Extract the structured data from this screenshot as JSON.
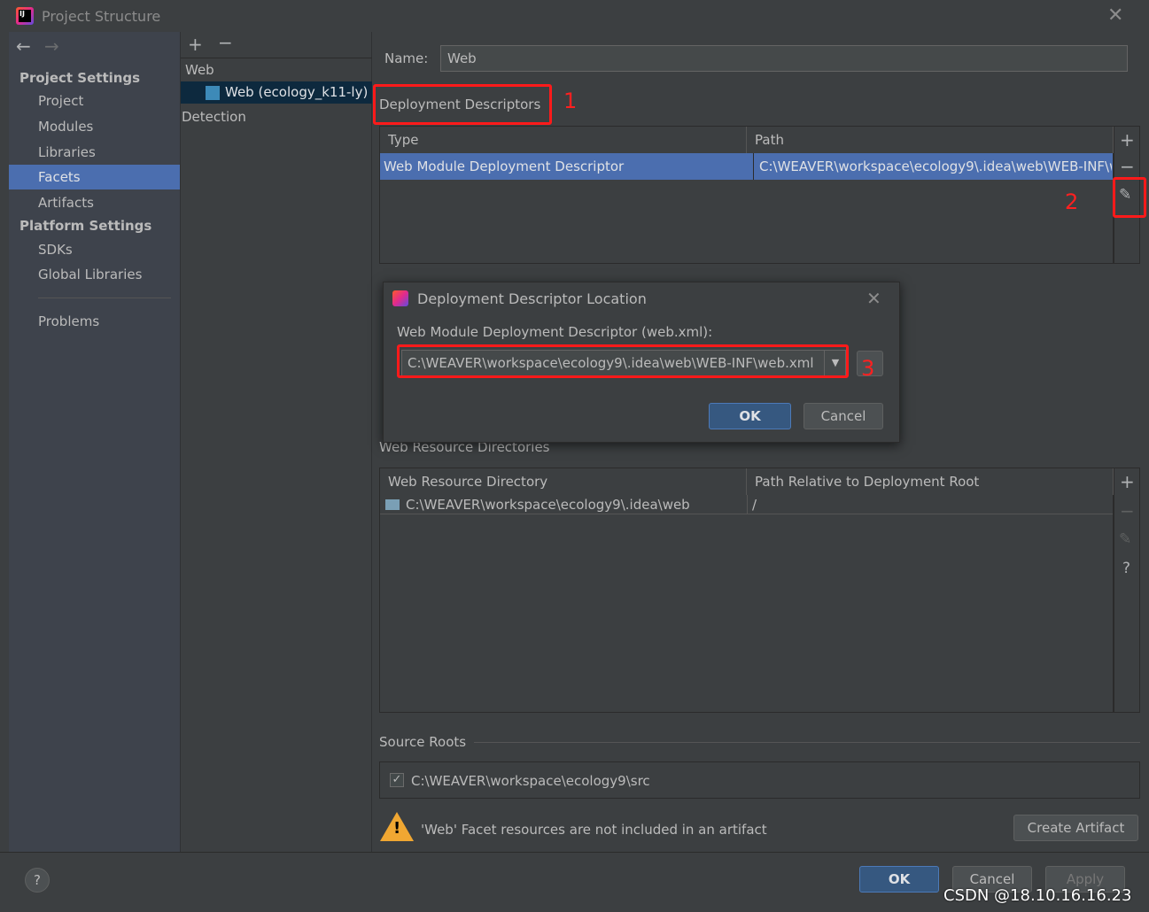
{
  "window": {
    "title": "Project Structure"
  },
  "sidebar": {
    "project_settings": "Project Settings",
    "items": [
      "Project",
      "Modules",
      "Libraries",
      "Facets",
      "Artifacts"
    ],
    "platform_settings": "Platform Settings",
    "platform_items": [
      "SDKs",
      "Global Libraries"
    ],
    "problems": "Problems",
    "selected": "Facets"
  },
  "tree": {
    "root": "Web",
    "child": "Web (ecology_k11-ly)",
    "detection": "Detection"
  },
  "main": {
    "name_label": "Name:",
    "name_value": "Web",
    "deployment_descriptors": "Deployment Descriptors",
    "dd_table": {
      "headers": [
        "Type",
        "Path"
      ],
      "rows": [
        [
          "Web Module Deployment Descriptor",
          "C:\\WEAVER\\workspace\\ecology9\\.idea\\web\\WEB-INF\\w"
        ]
      ]
    },
    "web_resource_directories": "Web Resource Directories",
    "wr_table": {
      "headers": [
        "Web Resource Directory",
        "Path Relative to Deployment Root"
      ],
      "rows": [
        [
          "C:\\WEAVER\\workspace\\ecology9\\.idea\\web",
          "/"
        ]
      ]
    },
    "source_roots": "Source Roots",
    "source_root": "C:\\WEAVER\\workspace\\ecology9\\src",
    "source_root_checked": true,
    "warning": "'Web' Facet resources are not included in an artifact",
    "create_artifact": "Create Artifact"
  },
  "dialog": {
    "title": "Deployment Descriptor Location",
    "label": "Web Module Deployment Descriptor (web.xml):",
    "path_value": "C:\\WEAVER\\workspace\\ecology9\\.idea\\web\\WEB-INF\\web.xml",
    "ok": "OK",
    "cancel": "Cancel"
  },
  "annotations": [
    "1",
    "2",
    "3"
  ],
  "footer": {
    "ok": "OK",
    "cancel": "Cancel",
    "apply": "Apply",
    "help": "?"
  },
  "watermark": "CSDN @18.10.16.16.23",
  "colors": {
    "selection": "#4b6eaf",
    "annotation": "#ff1a1a",
    "primary_button": "#365880"
  }
}
